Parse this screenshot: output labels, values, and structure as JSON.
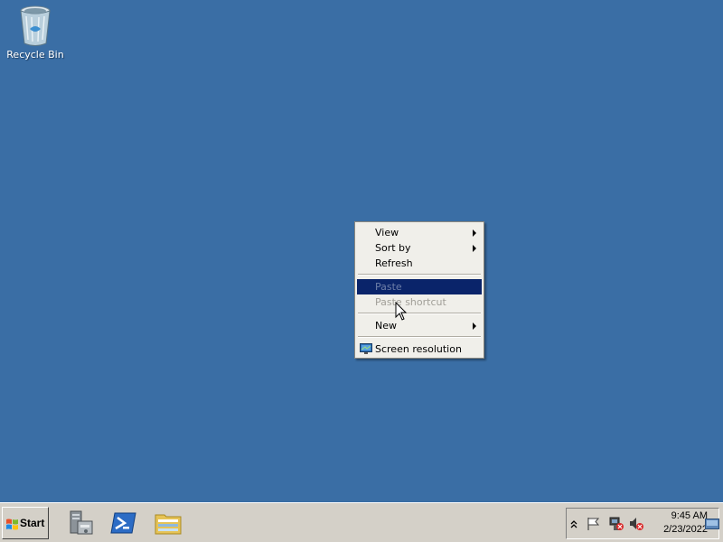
{
  "desktop": {
    "background": "#3a6ea5",
    "icons": [
      {
        "label": "Recycle Bin",
        "icon": "recycle-bin-icon"
      }
    ]
  },
  "context_menu": {
    "items": [
      {
        "label": "View",
        "has_submenu": true,
        "enabled": true
      },
      {
        "label": "Sort by",
        "has_submenu": true,
        "enabled": true
      },
      {
        "label": "Refresh",
        "has_submenu": false,
        "enabled": true
      },
      {
        "label": "Paste",
        "has_submenu": false,
        "enabled": false,
        "highlighted": true
      },
      {
        "label": "Paste shortcut",
        "has_submenu": false,
        "enabled": false
      },
      {
        "label": "New",
        "has_submenu": true,
        "enabled": true
      },
      {
        "label": "Screen resolution",
        "has_submenu": false,
        "enabled": true,
        "icon": "monitor-icon"
      }
    ],
    "highlight_color": "#0a246a"
  },
  "taskbar": {
    "start_label": "Start",
    "pinned": [
      {
        "icon": "server-manager-icon"
      },
      {
        "icon": "powershell-icon"
      },
      {
        "icon": "file-explorer-icon"
      }
    ],
    "tray": {
      "icons": [
        "show-hidden-icons-icon",
        "action-center-flag-icon",
        "network-icon",
        "volume-muted-icon"
      ],
      "time": "9:45 AM",
      "date": "2/23/2022"
    }
  }
}
